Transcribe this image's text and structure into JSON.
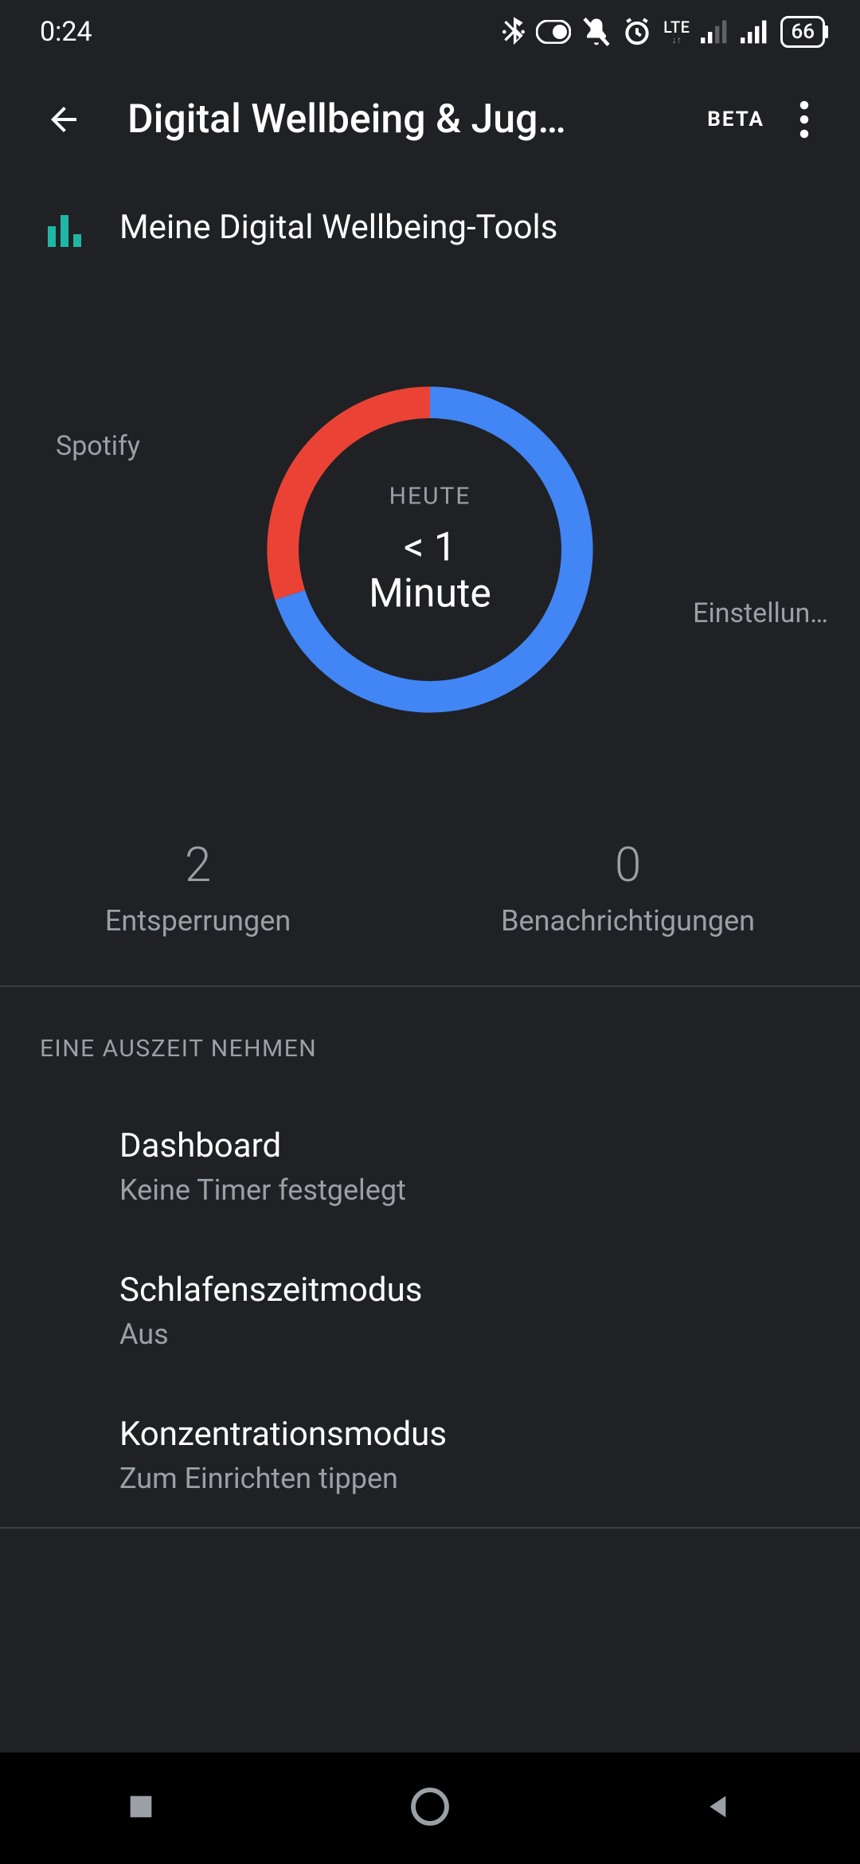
{
  "status": {
    "time": "0:24",
    "lte": "LTE",
    "battery": "66"
  },
  "appbar": {
    "title": "Digital Wellbeing & Jug…",
    "beta": "BETA"
  },
  "tools": {
    "label": "Meine Digital Wellbeing-Tools"
  },
  "chart_data": {
    "type": "pie",
    "title": "HEUTE",
    "center_value": "< 1 Minute",
    "series": [
      {
        "name": "Spotify",
        "value": 30,
        "color": "#ea4335"
      },
      {
        "name": "Einstellun…",
        "value": 70,
        "color": "#4285f4"
      }
    ]
  },
  "stats": {
    "unlocks": {
      "value": "2",
      "label": "Entsperrungen"
    },
    "notifications": {
      "value": "0",
      "label": "Benachrichtigungen"
    }
  },
  "section": {
    "header": "EINE AUSZEIT NEHMEN"
  },
  "settings": [
    {
      "title": "Dashboard",
      "sub": "Keine Timer festgelegt"
    },
    {
      "title": "Schlafenszeitmodus",
      "sub": "Aus"
    },
    {
      "title": "Konzentrationsmodus",
      "sub": "Zum Einrichten tippen"
    }
  ]
}
